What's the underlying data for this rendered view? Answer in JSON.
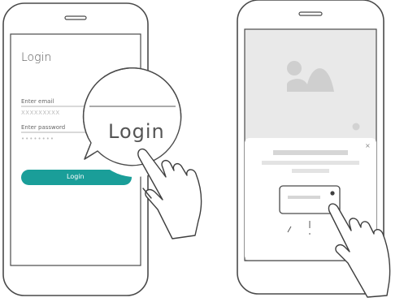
{
  "login_screen": {
    "title": "Login",
    "email_label": "Enter email",
    "email_value": "XXXXXXXXX",
    "password_label": "Enter password",
    "password_value": "••••••••",
    "button_label": "Login",
    "zoom_label": "Login"
  },
  "popup_screen": {
    "close_glyph": "×"
  },
  "colors": {
    "accent": "#1a9e99",
    "line": "#4a4a4a",
    "screen_gray": "#e9e9e9",
    "placeholder_bar": "#d6d6d6"
  }
}
